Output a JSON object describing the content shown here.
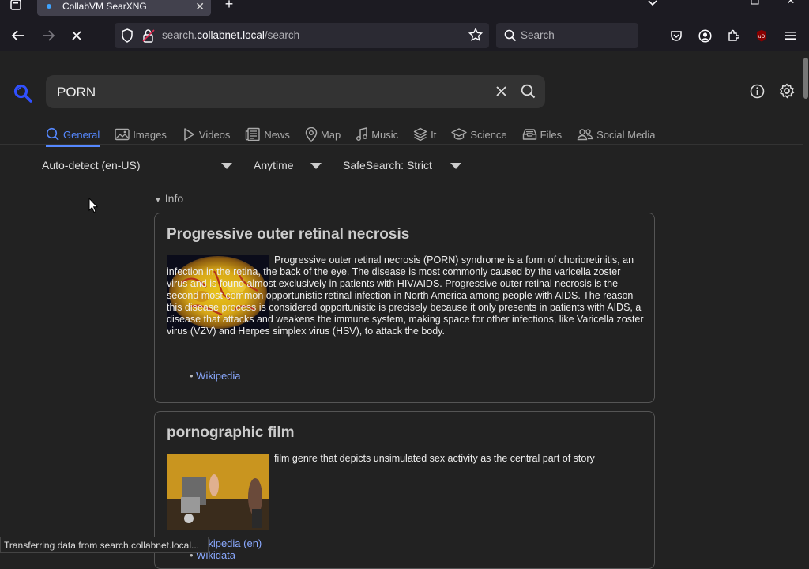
{
  "browser": {
    "tab_title": "CollabVM SearXNG",
    "url_prefix": "search.",
    "url_domain": "collabnet.local",
    "url_path": "/search",
    "search_placeholder": "Search"
  },
  "search": {
    "query": "PORN",
    "accent": "#5588ff"
  },
  "categories": [
    {
      "label": "General",
      "icon": "search-icon",
      "active": true
    },
    {
      "label": "Images",
      "icon": "image-icon"
    },
    {
      "label": "Videos",
      "icon": "play-icon"
    },
    {
      "label": "News",
      "icon": "newspaper-icon"
    },
    {
      "label": "Map",
      "icon": "map-pin-icon"
    },
    {
      "label": "Music",
      "icon": "music-icon"
    },
    {
      "label": "It",
      "icon": "layers-icon"
    },
    {
      "label": "Science",
      "icon": "graduation-cap-icon"
    },
    {
      "label": "Files",
      "icon": "archive-icon"
    },
    {
      "label": "Social Media",
      "icon": "users-icon"
    }
  ],
  "filters": {
    "language": "Auto-detect (en-US)",
    "time": "Anytime",
    "safesearch": "SafeSearch: Strict"
  },
  "info_label": "Info",
  "infoboxes": [
    {
      "title": "Progressive outer retinal necrosis",
      "description": "Progressive outer retinal necrosis (PORN) syndrome is a form of chorioretinitis, an infection in the retina, the back of the eye. The disease is most commonly caused by the varicella zoster virus and is found almost exclusively in patients with HIV/AIDS. Progressive outer retinal necrosis is the second most common opportunistic retinal infection in North America among people with AIDS. The reason this disease process is considered opportunistic is precisely because it only presents in patients with AIDS, a disease that attacks and weakens the immune system, making space for other infections, like Varicella zoster virus (VZV) and Herpes simplex virus (HSV), to attack the body.",
      "links": [
        "Wikipedia"
      ]
    },
    {
      "title": "pornographic film",
      "description": "film genre that depicts unsimulated sex activity as the central part of story",
      "links": [
        "Wikipedia (en)",
        "Wikidata"
      ]
    }
  ],
  "status": "Transferring data from search.collabnet.local..."
}
